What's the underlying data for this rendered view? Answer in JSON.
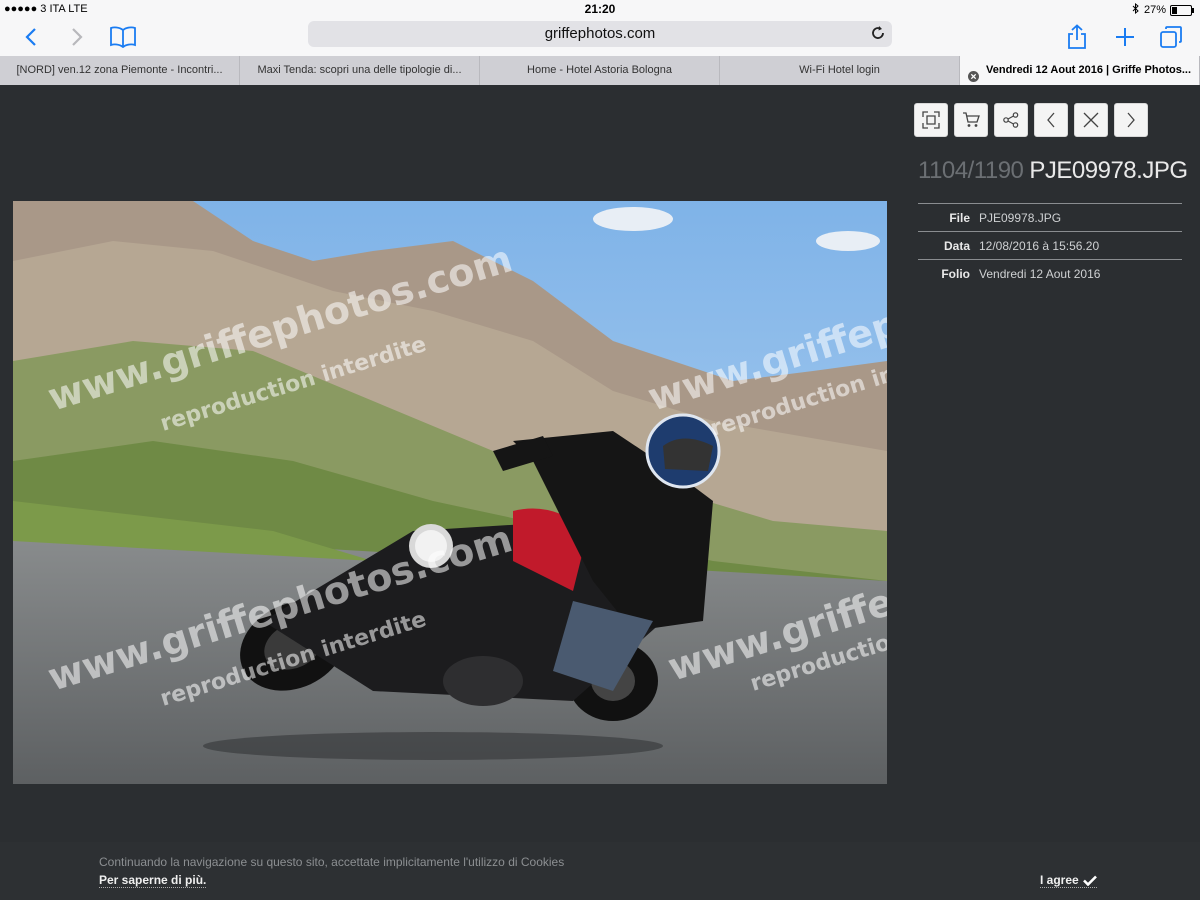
{
  "status": {
    "carrier": "●●●●● 3 ITA   LTE",
    "time": "21:20",
    "battery": "27%",
    "battery_level": 0.27
  },
  "browser": {
    "url": "griffephotos.com",
    "tabs": [
      {
        "label": "[NORD] ven.12 zona Piemonte - Incontri..."
      },
      {
        "label": "Maxi Tenda: scopri una delle tipologie di..."
      },
      {
        "label": "Home - Hotel Astoria Bologna"
      },
      {
        "label": "Wi-Fi Hotel login"
      },
      {
        "label": "Vendredi 12 Aout 2016 | Griffe Photos..."
      }
    ],
    "accent": "#1a7cf2"
  },
  "viewer": {
    "counter": "1104/1190",
    "filename": "PJE09978.JPG",
    "watermark": "www.griffephotos.com",
    "watermark_sub": "reproduction interdite",
    "meta": [
      {
        "key": "File",
        "value": "PJE09978.JPG"
      },
      {
        "key": "Data",
        "value": "12/08/2016 à 15:56.20"
      },
      {
        "key": "Folio",
        "value": "Vendredi 12 Aout 2016"
      }
    ],
    "toolbar_icons": [
      "fullscreen-icon",
      "cart-icon",
      "share-icon",
      "chevron-left-icon",
      "close-icon",
      "chevron-right-icon"
    ]
  },
  "cookie": {
    "message": "Continuando la navigazione su questo sito, accettate implicitamente l'utilizzo di Cookies",
    "more_link": "Per saperne di più.",
    "agree": "I agree"
  }
}
